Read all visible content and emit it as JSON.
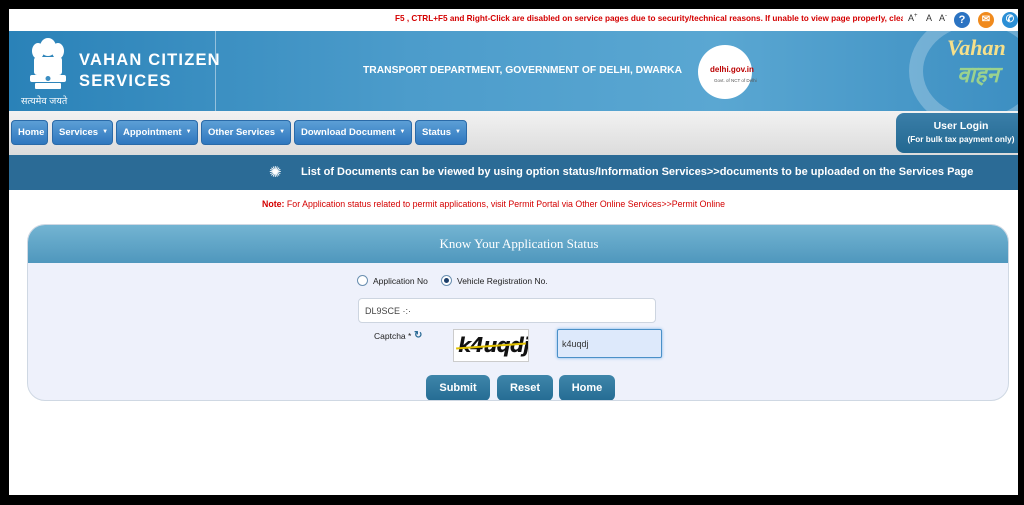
{
  "topbar": {
    "warning": "F5 , CTRL+F5 and Right-Click are disabled on service pages due to security/technical reasons. If unable to view page properly, clear y",
    "font_increase": "A",
    "font_normal": "A",
    "font_decrease": "A",
    "help_icon": "?",
    "mail_icon": "✉",
    "phone_icon": "✆"
  },
  "header": {
    "emblem_text": "सत्यमेव जयते",
    "brand_line1": "VAHAN CITIZEN",
    "brand_line2": "SERVICES",
    "department": "TRANSPORT DEPARTMENT, GOVERNMENT OF DELHI, DWARKA",
    "delhi_logo_text": "delhi.gov.in",
    "delhi_logo_sub": "Govt. of NCT of Delhi",
    "vahan_logo_line1": "Vahan",
    "vahan_logo_line2": "वाहन"
  },
  "nav": {
    "items": [
      {
        "label": "Home"
      },
      {
        "label": "Services"
      },
      {
        "label": "Appointment"
      },
      {
        "label": "Other Services"
      },
      {
        "label": "Download Document"
      },
      {
        "label": "Status"
      }
    ],
    "login_title": "User Login",
    "login_sub": "(For bulk tax payment only)"
  },
  "info_strip": {
    "message": "List of Documents can be viewed by using option status/Information Services>>documents to be uploaded on the Services Page"
  },
  "note": {
    "label": "Note:",
    "text": " For Application status related to permit applications, visit Permit Portal via Other Online Services>>Permit Online"
  },
  "status_form": {
    "title": "Know Your Application Status",
    "option_application": "Application No",
    "option_vehicle": "Vehicle Registration No.",
    "selected_option": "Vehicle Registration No.",
    "registration_value": "DL9SCE ·:·",
    "captcha_label": "Captcha *",
    "captcha_image_text": "k4uqdj",
    "captcha_value": "k4uqdj",
    "submit_label": "Submit",
    "reset_label": "Reset",
    "home_label": "Home"
  },
  "colors": {
    "header_blue": "#3d8fc2",
    "nav_button": "#2f77bf",
    "info_strip": "#2b6b96",
    "note_red": "#d40000",
    "panel_head": "#5aa3c8",
    "action_button": "#2b729a"
  }
}
